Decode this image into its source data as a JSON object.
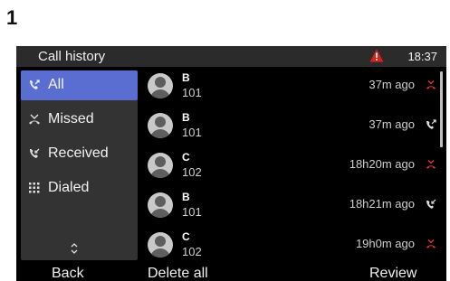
{
  "step_number": "1",
  "header": {
    "title": "Call history",
    "time": "18:37"
  },
  "sidebar": {
    "items": [
      {
        "label": "All",
        "icon": "all-calls-icon",
        "active": true
      },
      {
        "label": "Missed",
        "icon": "missed-call-icon",
        "active": false
      },
      {
        "label": "Received",
        "icon": "received-call-icon",
        "active": false
      },
      {
        "label": "Dialed",
        "icon": "dialpad-icon",
        "active": false
      }
    ]
  },
  "calls": [
    {
      "name": "B",
      "number": "101",
      "time": "37m ago",
      "status": "missed"
    },
    {
      "name": "B",
      "number": "101",
      "time": "37m ago",
      "status": "dialed"
    },
    {
      "name": "C",
      "number": "102",
      "time": "18h20m ago",
      "status": "missed"
    },
    {
      "name": "B",
      "number": "101",
      "time": "18h21m ago",
      "status": "received"
    },
    {
      "name": "C",
      "number": "102",
      "time": "19h0m ago",
      "status": "missed"
    }
  ],
  "softkeys": {
    "left": "Back",
    "middle": "Delete all",
    "right": "Review"
  },
  "colors": {
    "active_item": "#5a6ed1",
    "missed": "#e53935",
    "warning": "#e0201c",
    "screen_bg": "#000000"
  }
}
